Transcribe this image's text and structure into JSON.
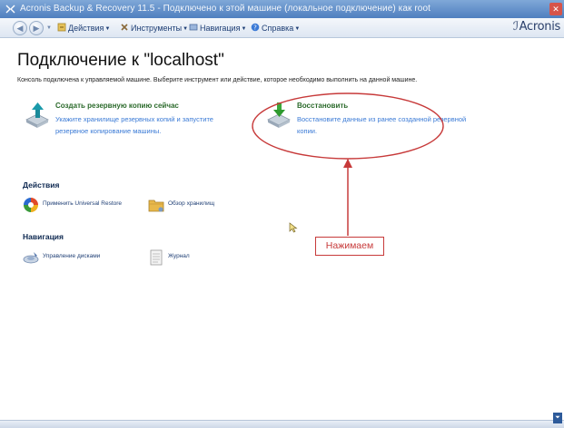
{
  "window": {
    "title": "Acronis Backup & Recovery 11.5 - Подключено к этой машине (локальное подключение) как root",
    "close_glyph": "✕"
  },
  "menubar": {
    "back_glyph": "◀",
    "forward_glyph": "▶",
    "items": [
      {
        "label": "Действия",
        "icon": "actions-icon"
      },
      {
        "label": "Инструменты",
        "icon": "tools-icon"
      },
      {
        "label": "Навигация",
        "icon": "navigation-icon"
      },
      {
        "label": "Справка",
        "icon": "help-icon"
      }
    ],
    "brand": "Acronis"
  },
  "page": {
    "title": "Подключение к \"localhost\"",
    "description": "Консоль подключена к управляемой машине. Выберите инструмент или действие, которое необходимо выполнить на данной машине."
  },
  "tasks": {
    "backup": {
      "title": "Создать резервную копию сейчас",
      "description": "Укажите хранилище резервных копий и запустите резервное копирование машины.",
      "icon": "backup-upload-icon"
    },
    "restore": {
      "title": "Восстановить",
      "description": "Восстановите данные из ранее созданной резервной копии.",
      "icon": "restore-download-icon"
    }
  },
  "sections": {
    "actions": {
      "heading": "Действия",
      "items": [
        {
          "label": "Применить Universal Restore",
          "icon": "universal-restore-icon"
        },
        {
          "label": "Обзор хранилищ",
          "icon": "vault-folder-icon"
        }
      ]
    },
    "navigation": {
      "heading": "Навигация",
      "items": [
        {
          "label": "Управление дисками",
          "icon": "disk-management-icon"
        },
        {
          "label": "Журнал",
          "icon": "log-icon"
        }
      ]
    }
  },
  "annotation": {
    "label": "Нажимаем",
    "color": "#c73a3a"
  },
  "colors": {
    "task_title": "#2b6a2b",
    "task_desc": "#3a7ad6",
    "menu_text": "#1f3f75"
  }
}
